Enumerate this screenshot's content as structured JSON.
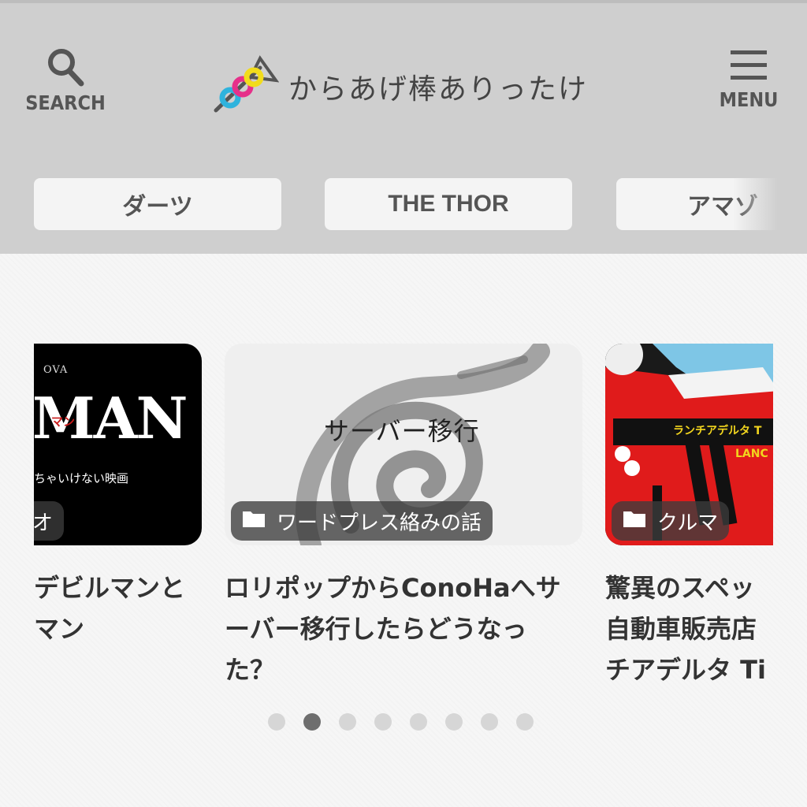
{
  "header": {
    "search_label": "SEARCH",
    "menu_label": "MENU",
    "site_title": "からあげ棒ありったけ"
  },
  "tabs": [
    {
      "label": "ダーツ"
    },
    {
      "label": "THE THOR"
    },
    {
      "label": "アマゾ"
    }
  ],
  "slides": [
    {
      "thumb_small_text": "OVA",
      "thumb_big_text": "MAN",
      "thumb_red_text": "マン",
      "thumb_caption": "ちゃいけない映画",
      "category": "オ",
      "title_line1": "デビルマンと",
      "title_line2": "マン"
    },
    {
      "thumb_text": "サーバー移行",
      "category": "ワードプレス絡みの話",
      "title_line1": "ロリポップからConoHaへサ",
      "title_line2": "ーバー移行したらどうなっ",
      "title_line3": "た？"
    },
    {
      "thumb_banner": "ランチアデルタ T",
      "thumb_sub": "LANC",
      "category": "クルマ",
      "title_line1": "驚異のスペッ",
      "title_line2": "自動車販売店",
      "title_line3": "チアデルタ Ti"
    }
  ],
  "pagination": {
    "count": 8,
    "active_index": 1
  },
  "colors": {
    "header_bg": "#cfcfcf",
    "tab_bg": "#f4f4f4",
    "badge_bg": "#3c3c3c",
    "dot_active": "#6e6e6e",
    "dot_inactive": "#d6d6d6"
  }
}
